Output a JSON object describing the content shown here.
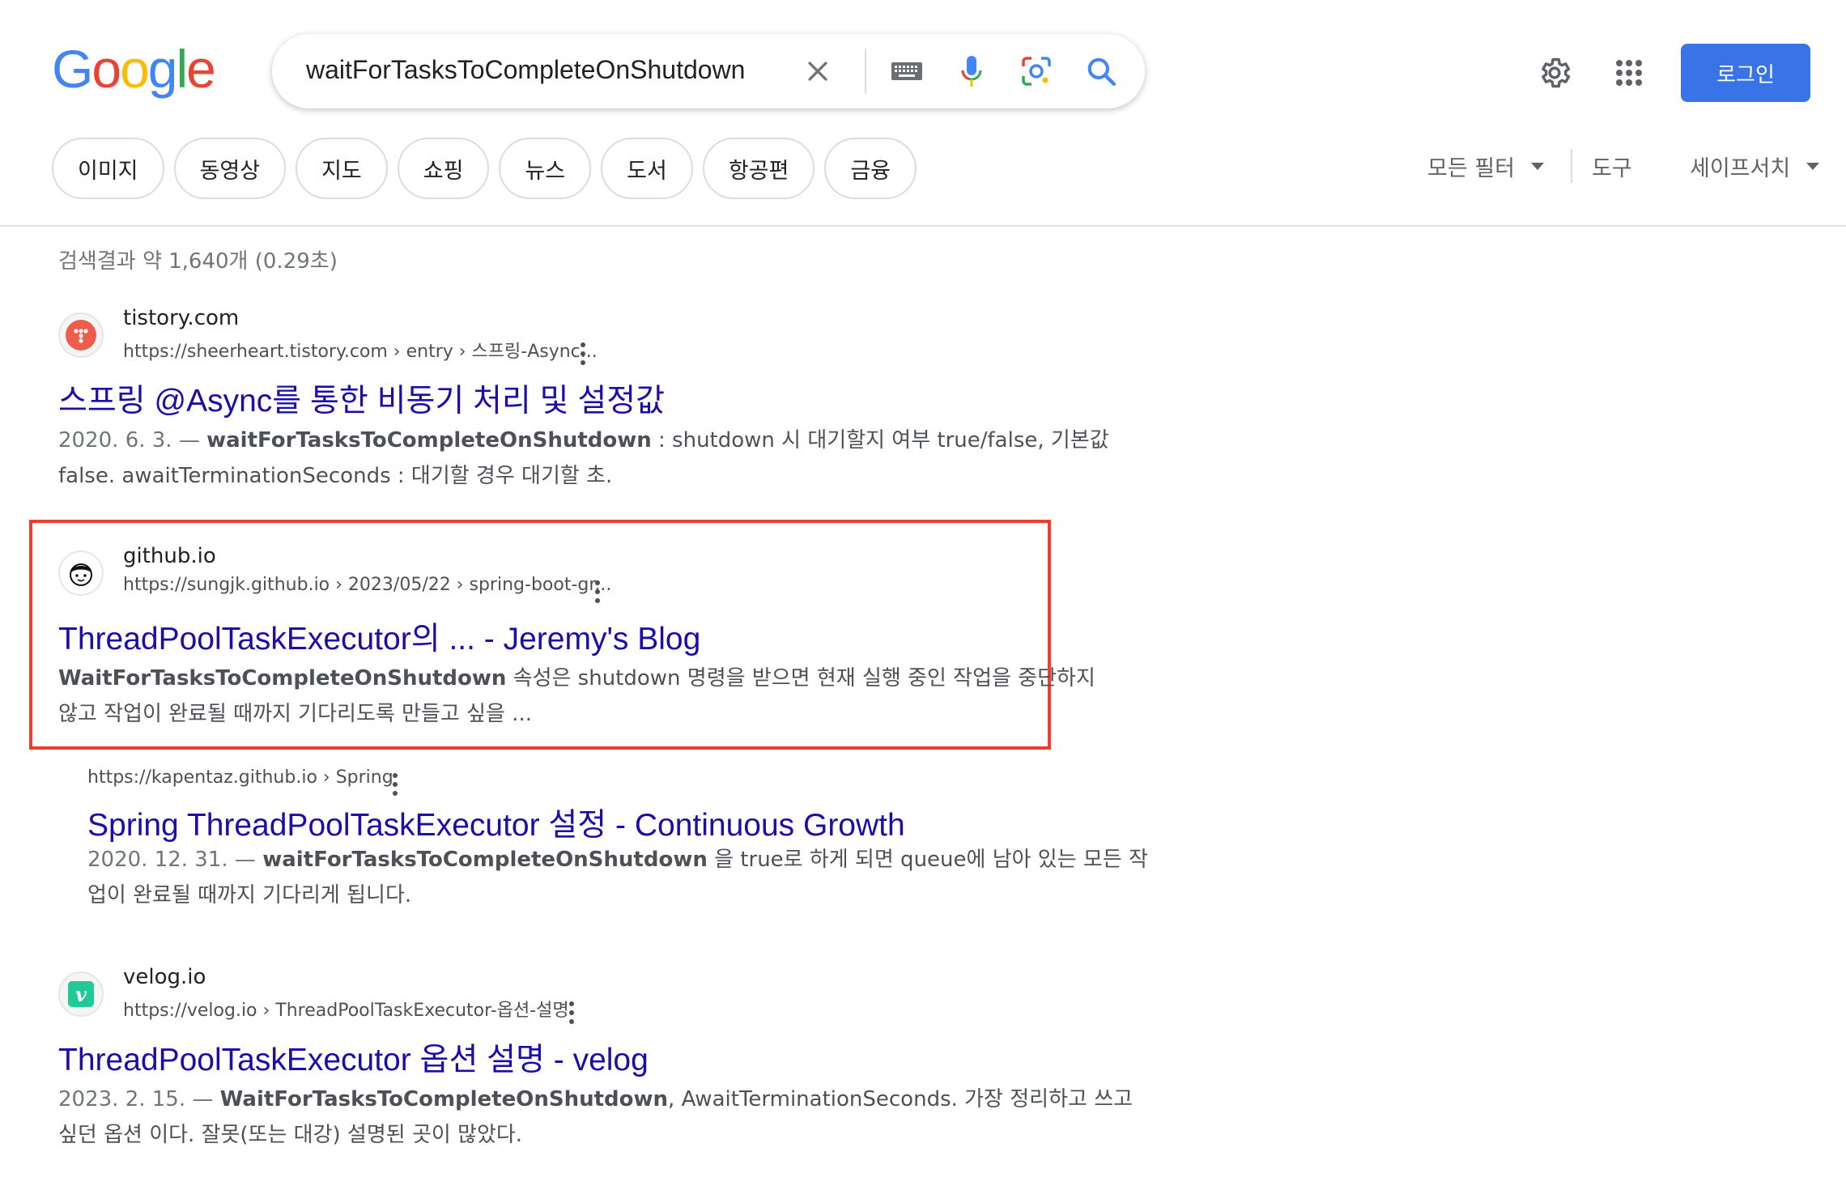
{
  "logo": {
    "text": "Google"
  },
  "search": {
    "query": "waitForTasksToCompleteOnShutdown",
    "icons": [
      "clear-icon",
      "keyboard-icon",
      "microphone-icon",
      "lens-icon",
      "search-icon"
    ]
  },
  "header": {
    "login_label": "로그인",
    "icons": [
      "settings-icon",
      "apps-grid-icon"
    ]
  },
  "chips": [
    "이미지",
    "동영상",
    "지도",
    "쇼핑",
    "뉴스",
    "도서",
    "항공편",
    "금융"
  ],
  "tools": {
    "all_filters": "모든 필터",
    "tools": "도구",
    "safesearch": "세이프서치"
  },
  "stats": "검색결과 약 1,640개 (0.29초)",
  "results": [
    {
      "site_name": "tistory.com",
      "url": "https://sheerheart.tistory.com › entry › 스프링-Async...",
      "title": "스프링 @Async를 통한 비동기 처리 및 설정값",
      "date": "2020. 6. 3. — ",
      "bold": "waitForTasksToCompleteOnShutdown",
      "snippet_rest": " : shutdown 시 대기할지 여부 true/false, 기본값",
      "snippet_line2": "false. awaitTerminationSeconds : 대기할 경우 대기할 초.",
      "favicon": "tistory-icon"
    },
    {
      "site_name": "github.io",
      "url": "https://sungjk.github.io › 2023/05/22 › spring-boot-gr...",
      "title": "ThreadPoolTaskExecutor의 ... - Jeremy's Blog",
      "date": "",
      "bold": "WaitForTasksToCompleteOnShutdown",
      "snippet_rest": " 속성은 shutdown 명령을 받으면 현재 실행 중인 작업을 중단하지",
      "snippet_line2": "않고 작업이 완료될 때까지 기다리도록 만들고 싶을 ...",
      "favicon": "avatar-icon"
    },
    {
      "site_name": "",
      "url": "https://kapentaz.github.io › Spring",
      "title": "Spring ThreadPoolTaskExecutor 설정 - Continuous Growth",
      "date": "2020. 12. 31. — ",
      "bold": "waitForTasksToCompleteOnShutdown",
      "snippet_rest": " 을 true로 하게 되면 queue에 남아 있는 모든 작",
      "snippet_line2": "업이 완료될 때까지 기다리게 됩니다.",
      "favicon": ""
    },
    {
      "site_name": "velog.io",
      "url": "https://velog.io › ThreadPoolTaskExecutor-옵션-설명",
      "title": "ThreadPoolTaskExecutor 옵션 설명 - velog",
      "date": "2023. 2. 15. — ",
      "bold": "WaitForTasksToCompleteOnShutdown",
      "snippet_rest": ", AwaitTerminationSeconds. 가장 정리하고 쓰고",
      "snippet_line2": "싶던 옵션 이다. 잘못(또는 대강) 설명된 곳이 많았다.",
      "favicon": "velog-icon"
    }
  ],
  "colors": {
    "link": "#1a0dab",
    "login_bg": "#3874e8",
    "highlight_border": "#e8412f"
  }
}
